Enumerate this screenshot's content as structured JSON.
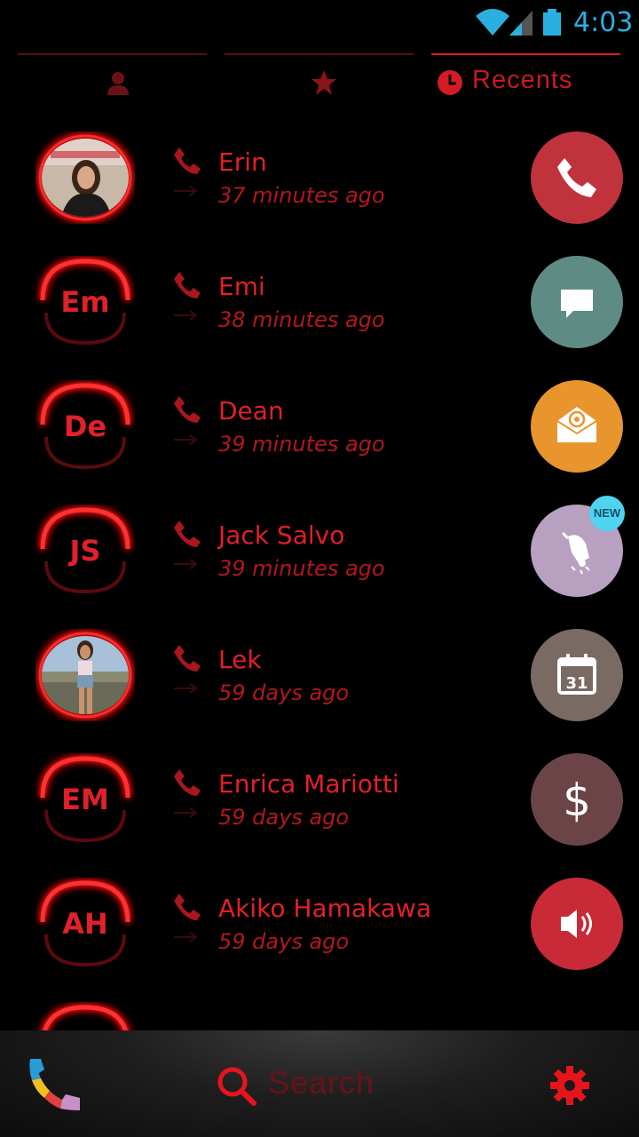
{
  "status_bar": {
    "time": "4:03",
    "icons": [
      "wifi-icon",
      "signal-icon",
      "battery-icon"
    ],
    "color": "#2ab0e0"
  },
  "tabs": [
    {
      "icon": "person-icon",
      "label": "",
      "active": false
    },
    {
      "icon": "star-icon",
      "label": "",
      "active": false
    },
    {
      "icon": "clock-icon",
      "label": "Recents",
      "active": true
    }
  ],
  "contacts": [
    {
      "name": "Erin",
      "time": "37 minutes ago",
      "initials": "",
      "has_photo": true
    },
    {
      "name": "Emi",
      "time": "38 minutes ago",
      "initials": "Em",
      "has_photo": false
    },
    {
      "name": "Dean",
      "time": "39 minutes ago",
      "initials": "De",
      "has_photo": false
    },
    {
      "name": "Jack Salvo",
      "time": "39 minutes ago",
      "initials": "JS",
      "has_photo": false
    },
    {
      "name": "Lek",
      "time": "59 days ago",
      "initials": "",
      "has_photo": true
    },
    {
      "name": "Enrica Mariotti",
      "time": "59 days ago",
      "initials": "EM",
      "has_photo": false
    },
    {
      "name": "Akiko Hamakawa",
      "time": "59 days ago",
      "initials": "AH",
      "has_photo": false
    }
  ],
  "quick_actions": [
    {
      "icon": "phone-icon",
      "color": "#c0323c"
    },
    {
      "icon": "message-icon",
      "color": "#5e8c84"
    },
    {
      "icon": "email-icon",
      "color": "#e8952e"
    },
    {
      "icon": "alarm-bell-icon",
      "color": "#b8a0c0",
      "badge": "NEW"
    },
    {
      "icon": "calendar-icon",
      "color": "#7a6a64",
      "calendar_day": "31"
    },
    {
      "icon": "dollar-icon",
      "color": "#6a4446"
    },
    {
      "icon": "volume-icon",
      "color": "#c82a38"
    }
  ],
  "bottom_bar": {
    "search_label": "Search",
    "icons": [
      "app-logo-icon",
      "search-icon",
      "settings-gear-icon"
    ]
  },
  "colors": {
    "accent_red": "#e0202a",
    "ring_glow": "#ff2020",
    "background": "#000000"
  }
}
